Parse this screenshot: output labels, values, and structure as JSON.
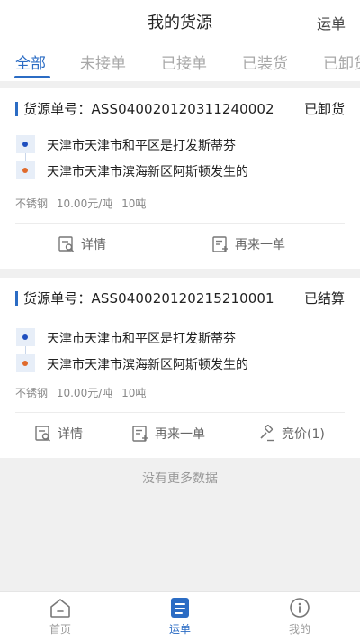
{
  "header": {
    "title": "我的货源",
    "right_action": "运单"
  },
  "tabs": [
    {
      "label": "全部",
      "active": true
    },
    {
      "label": "未接单",
      "active": false
    },
    {
      "label": "已接单",
      "active": false
    },
    {
      "label": "已装货",
      "active": false
    },
    {
      "label": "已卸货",
      "active": false
    }
  ],
  "orders": [
    {
      "label": "货源单号：",
      "number": "ASS040020120311240002",
      "status": "已卸货",
      "from": "天津市天津市和平区是打发斯蒂芬",
      "to": "天津市天津市滨海新区阿斯顿发生的",
      "cargo": "不锈钢",
      "price": "10.00元/吨",
      "weight": "10吨",
      "actions": {
        "detail": "详情",
        "reorder": "再来一单"
      }
    },
    {
      "label": "货源单号：",
      "number": "ASS040020120215210001",
      "status": "已结算",
      "from": "天津市天津市和平区是打发斯蒂芬",
      "to": "天津市天津市滨海新区阿斯顿发生的",
      "cargo": "不锈钢",
      "price": "10.00元/吨",
      "weight": "10吨",
      "actions": {
        "detail": "详情",
        "reorder": "再来一单",
        "bid": "竞价(1)"
      }
    }
  ],
  "no_more": "没有更多数据",
  "bottom_nav": [
    {
      "label": "首页",
      "icon": "home-icon",
      "active": false
    },
    {
      "label": "运单",
      "icon": "waybill-icon",
      "active": true
    },
    {
      "label": "我的",
      "icon": "profile-icon",
      "active": false
    }
  ],
  "colors": {
    "accent": "#2b6cc4",
    "start_dot": "#1f4fbf",
    "end_dot": "#e06a2b",
    "background": "#f0f0f0"
  }
}
